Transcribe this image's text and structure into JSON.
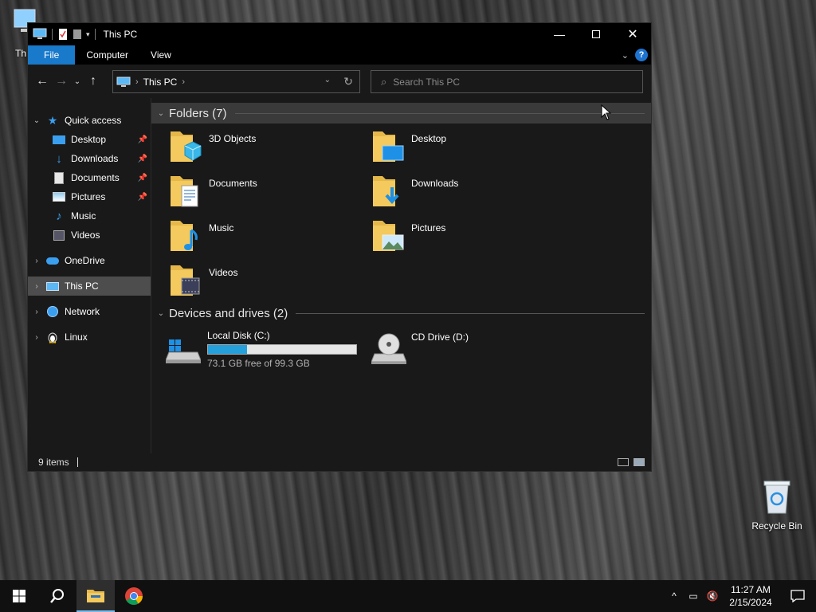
{
  "desktop": {
    "this_pc_label": "Th",
    "recycle_bin_label": "Recycle Bin"
  },
  "window": {
    "title": "This PC",
    "ribbon_tabs": [
      "File",
      "Computer",
      "View"
    ],
    "address": {
      "crumb": "This PC"
    },
    "search": {
      "placeholder": "Search This PC"
    }
  },
  "sidebar": {
    "quick_access": "Quick access",
    "pinned": [
      "Desktop",
      "Downloads",
      "Documents",
      "Pictures"
    ],
    "unpinned": [
      "Music",
      "Videos"
    ],
    "onedrive": "OneDrive",
    "this_pc": "This PC",
    "network": "Network",
    "linux": "Linux"
  },
  "content": {
    "folders_header": "Folders (7)",
    "folders": [
      "3D Objects",
      "Desktop",
      "Documents",
      "Downloads",
      "Music",
      "Pictures",
      "Videos"
    ],
    "devices_header": "Devices and drives (2)",
    "drives": [
      {
        "name": "Local Disk (C:)",
        "free_text": "73.1 GB free of 99.3 GB",
        "used_fraction": 0.264
      },
      {
        "name": "CD Drive (D:)"
      }
    ]
  },
  "status": {
    "items": "9 items"
  },
  "taskbar": {
    "time": "11:27 AM",
    "date": "2/15/2024"
  },
  "colors": {
    "accent": "#1979ca",
    "drive_bar": "#26a0da",
    "folder": "#f4c95d"
  }
}
